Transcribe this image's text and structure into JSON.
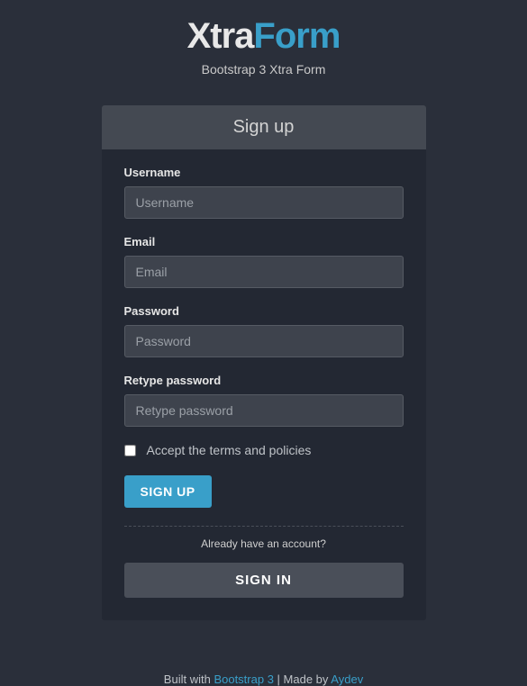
{
  "brand": {
    "title_part1": "Xtra",
    "title_part2": "Form",
    "subtitle": "Bootstrap 3 Xtra Form"
  },
  "panel": {
    "heading": "Sign up"
  },
  "form": {
    "username": {
      "label": "Username",
      "placeholder": "Username",
      "value": ""
    },
    "email": {
      "label": "Email",
      "placeholder": "Email",
      "value": ""
    },
    "password": {
      "label": "Password",
      "placeholder": "Password",
      "value": ""
    },
    "retype": {
      "label": "Retype password",
      "placeholder": "Retype password",
      "value": ""
    },
    "terms": {
      "label": "Accept the terms and policies",
      "checked": false
    },
    "signup_button": "SIGN UP",
    "already_text": "Already have an account?",
    "signin_button": "SIGN IN"
  },
  "footer": {
    "built_with": "Built with ",
    "bootstrap_link": "Bootstrap 3",
    "separator": " | Made by ",
    "author_link": "Aydev"
  }
}
